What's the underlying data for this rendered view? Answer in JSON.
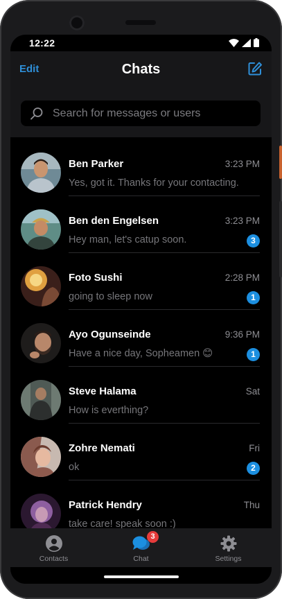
{
  "status_bar": {
    "time": "12:22",
    "icons": [
      "wifi-icon",
      "cellular-signal-icon",
      "battery-icon"
    ]
  },
  "header": {
    "edit_label": "Edit",
    "title": "Chats",
    "compose_icon": "compose-icon"
  },
  "search": {
    "placeholder": "Search for messages or users",
    "value": ""
  },
  "colors": {
    "accent": "#2f8fd8",
    "badge": "#1c8fe0",
    "notification": "#e63b3b",
    "background": "#000000",
    "header": "#171719"
  },
  "chats": [
    {
      "name": "Ben Parker",
      "time": "3:23 PM",
      "message": "Yes, got it. Thanks for your contacting.",
      "unread": ""
    },
    {
      "name": "Ben den Engelsen",
      "time": "3:23 PM",
      "message": "Hey man, let's catup soon.",
      "unread": "3"
    },
    {
      "name": "Foto Sushi",
      "time": "2:28 PM",
      "message": "going to sleep now",
      "unread": "1"
    },
    {
      "name": "Ayo Ogunseinde",
      "time": "9:36 PM",
      "message": "Have a nice day, Sopheamen 😊",
      "unread": "1"
    },
    {
      "name": "Steve Halama",
      "time": "Sat",
      "message": "How is everthing?",
      "unread": ""
    },
    {
      "name": "Zohre Nemati",
      "time": "Fri",
      "message": "ok",
      "unread": "2"
    },
    {
      "name": "Patrick Hendry",
      "time": "Thu",
      "message": "take care! speak soon :)",
      "unread": ""
    }
  ],
  "tabs": [
    {
      "label": "Contacts",
      "icon": "person-circle-icon",
      "active": false
    },
    {
      "label": "Chat",
      "icon": "chat-bubbles-icon",
      "active": true,
      "badge": "3"
    },
    {
      "label": "Settings",
      "icon": "gear-icon",
      "active": false
    }
  ]
}
